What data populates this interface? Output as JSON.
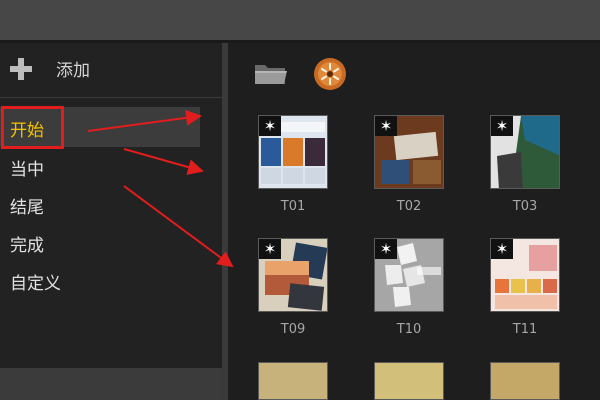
{
  "sidebar": {
    "add_label": "添加",
    "categories": [
      "开始",
      "当中",
      "结尾",
      "完成",
      "自定义"
    ],
    "selected_index": 0
  },
  "toolbar": {
    "icons": [
      "folder-icon",
      "disc-icon"
    ]
  },
  "templates": [
    {
      "label": "T01"
    },
    {
      "label": "T02"
    },
    {
      "label": "T03"
    },
    {
      "label": "T09"
    },
    {
      "label": "T10"
    },
    {
      "label": "T11"
    }
  ],
  "colors": {
    "highlight": "#e11d1d",
    "arrow": "#e11d1d"
  }
}
